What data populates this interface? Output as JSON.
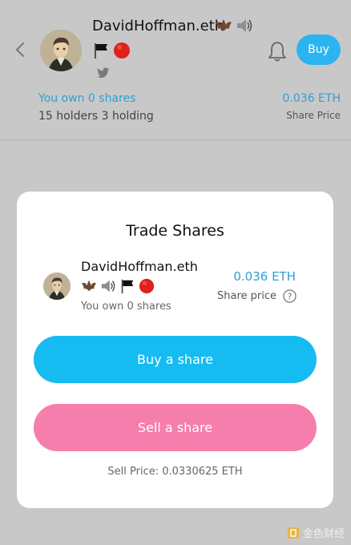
{
  "header": {
    "name": "DavidHoffman.eth",
    "own_link": "You own 0 shares",
    "holders": "15 holders  3 holding",
    "price": "0.036 ETH",
    "price_label": "Share Price",
    "buy_label": "Buy",
    "icons": [
      "back-arrow-icon",
      "twitter-icon",
      "bell-icon"
    ],
    "emojis": [
      "bat",
      "speaker",
      "black-flag",
      "red-circle"
    ]
  },
  "modal": {
    "title": "Trade Shares",
    "name": "DavidHoffman.eth",
    "own_text": "You own 0 shares",
    "price": "0.036 ETH",
    "price_label": "Share price",
    "buy_button": "Buy a share",
    "sell_button": "Sell a share",
    "sell_price": "Sell Price: 0.0330625 ETH"
  },
  "watermark": "金色财经",
  "colors": {
    "accent_blue": "#16bbf2",
    "link_blue": "#2f9fd3",
    "sell_pink": "#f67eac",
    "overlay_gray": "#c8c8c8"
  }
}
